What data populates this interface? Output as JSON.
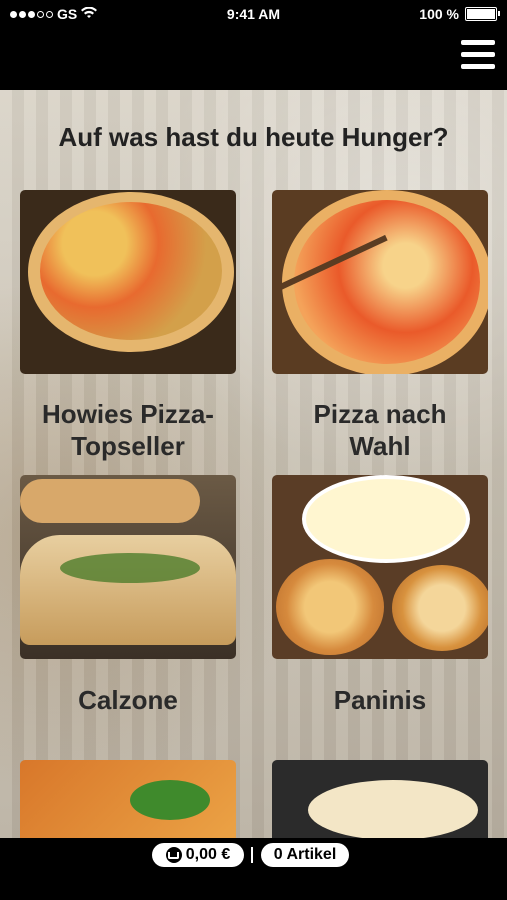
{
  "status_bar": {
    "carrier": "GS",
    "time": "9:41 AM",
    "battery": "100 %"
  },
  "header": {
    "menu_icon": "hamburger-menu-icon"
  },
  "main": {
    "headline": "Auf was hast du heute Hunger?",
    "categories": [
      {
        "title_line1": "Howies Pizza-",
        "title_line2": "Topseller"
      },
      {
        "title_line1": "Pizza nach",
        "title_line2": "Wahl"
      },
      {
        "title_line1": "Calzone",
        "title_line2": ""
      },
      {
        "title_line1": "Paninis",
        "title_line2": ""
      }
    ]
  },
  "cart": {
    "total": "0,00 €",
    "items": "0 Artikel",
    "icon": "cart-icon"
  }
}
